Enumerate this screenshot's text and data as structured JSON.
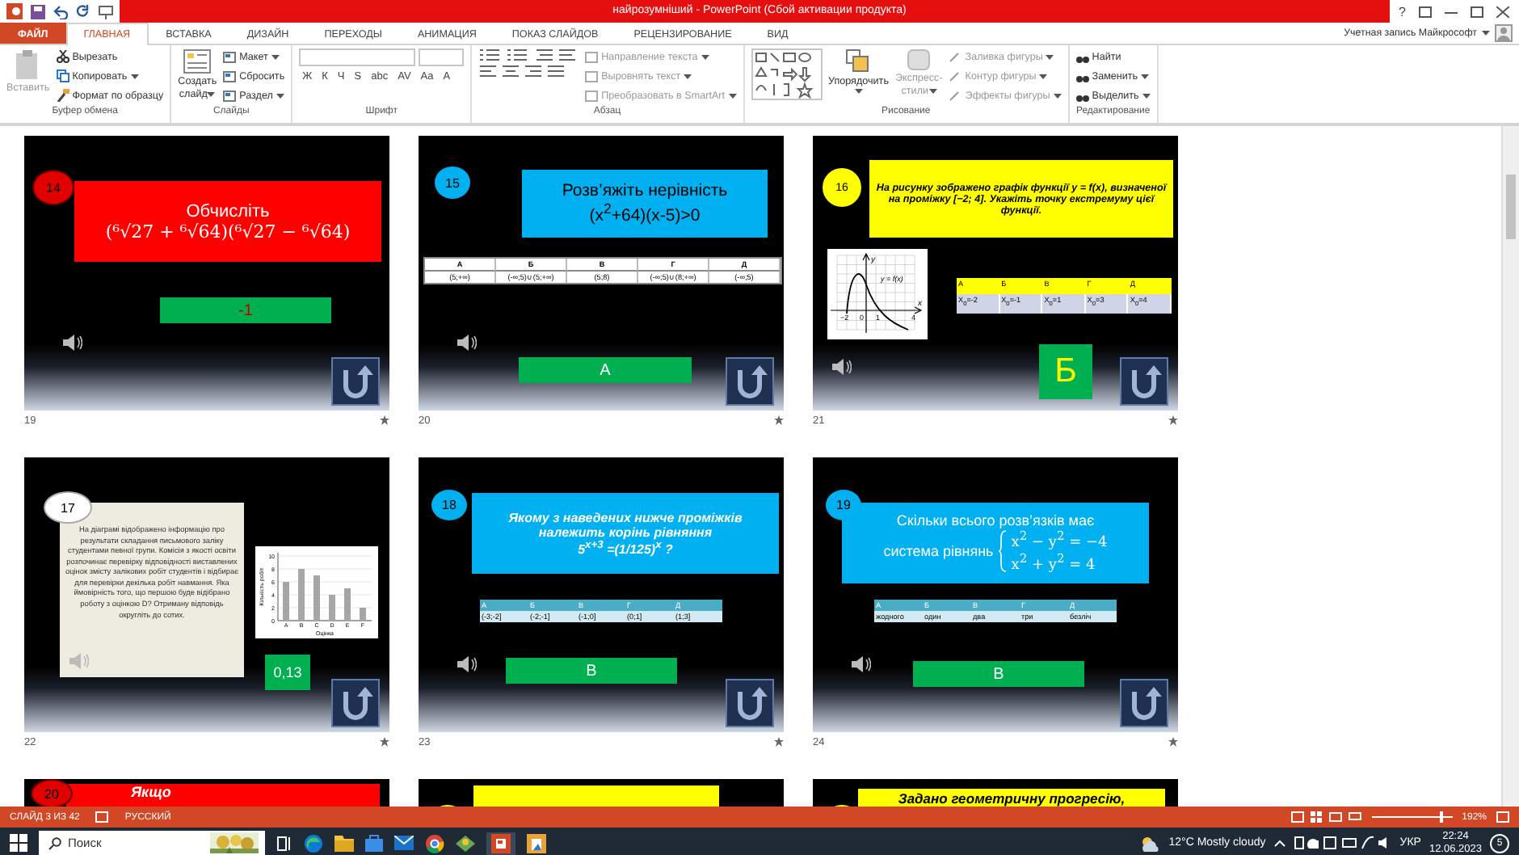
{
  "window": {
    "title": "найрозумніший - PowerPoint (Сбой активации продукта)",
    "help": "?"
  },
  "tabs": [
    {
      "label": "ФАЙЛ",
      "kind": "file",
      "selected": false
    },
    {
      "label": "ГЛАВНАЯ",
      "kind": "tab",
      "selected": true
    },
    {
      "label": "ВСТАВКА",
      "kind": "tab",
      "selected": false
    },
    {
      "label": "ДИЗАЙН",
      "kind": "tab",
      "selected": false
    },
    {
      "label": "ПЕРЕХОДЫ",
      "kind": "tab",
      "selected": false
    },
    {
      "label": "АНИМАЦИЯ",
      "kind": "tab",
      "selected": false
    },
    {
      "label": "ПОКАЗ СЛАЙДОВ",
      "kind": "tab",
      "selected": false
    },
    {
      "label": "РЕЦЕНЗИРОВАНИЕ",
      "kind": "tab",
      "selected": false
    },
    {
      "label": "ВИД",
      "kind": "tab",
      "selected": false
    }
  ],
  "account": "Учетная запись Майкрософт",
  "ribbon": {
    "clipboard": {
      "paste": "Вставить",
      "items": [
        {
          "label": "Вырезать",
          "menu": false
        },
        {
          "label": "Копировать",
          "menu": true
        },
        {
          "label": "Формат по образцу",
          "menu": false
        }
      ],
      "group": "Буфер обмена"
    },
    "slides": {
      "new": [
        "Создать",
        "слайд"
      ],
      "items": [
        {
          "label": "Макет",
          "menu": true
        },
        {
          "label": "Сбросить",
          "menu": false
        },
        {
          "label": "Раздел",
          "menu": true
        }
      ],
      "group": "Слайды"
    },
    "font": {
      "buttons": [
        "Ж",
        "К",
        "Ч",
        "S",
        "abc",
        "AV",
        "Aa",
        "A"
      ],
      "group": "Шрифт"
    },
    "paragraph": {
      "items": [
        {
          "label": "Направление текста",
          "disabled": true
        },
        {
          "label": "Выровнять текст",
          "disabled": true
        },
        {
          "label": "Преобразовать в SmartArt",
          "disabled": true
        }
      ],
      "group": "Абзац"
    },
    "drawing": {
      "arrange": "Упорядочить",
      "styles": [
        "Экспресс-",
        "стили"
      ],
      "styles_disabled": true,
      "items": [
        {
          "label": "Заливка фигуры",
          "disabled": true
        },
        {
          "label": "Контур фигуры",
          "disabled": true
        },
        {
          "label": "Эффекты фигуры",
          "disabled": true
        }
      ],
      "group": "Рисование"
    },
    "editing": {
      "items": [
        {
          "label": "Найти",
          "menu": false
        },
        {
          "label": "Заменить",
          "menu": true
        },
        {
          "label": "Выделить",
          "menu": true
        }
      ],
      "group": "Редактирование"
    }
  },
  "slides": [
    {
      "kind": "compute",
      "number": "19",
      "badge": "14",
      "question": {
        "lines": [
          "Обчисліть"
        ],
        "formula": "(⁶√27 + ⁶√64)(⁶√27 − ⁶√64)"
      },
      "answer": "-1"
    },
    {
      "kind": "inequality",
      "number": "20",
      "badge": "15",
      "question": {
        "lines": [
          "Розв’яжіть нерівність"
        ],
        "formula": "(x$^{2}$+64)(x-5)>0"
      },
      "table": {
        "headers": [
          "А",
          "Б",
          "В",
          "Г",
          "Д"
        ],
        "cells": [
          "(5;+∞)",
          "(-∞;5)∪(5;+∞)",
          "(5;8)",
          "(-∞;5)∪(8;+∞)",
          "(-∞;5)"
        ]
      },
      "answer": "А"
    },
    {
      "kind": "graph",
      "number": "21",
      "badge": "16",
      "question": {
        "lines": [
          "На рисунку зображено графік функції y = f(x), визначеної на проміжку [−2; 4]. Укажіть точку екстремуму цієї функції."
        ]
      },
      "graph": {
        "y_axis": "y",
        "x_axis": "x",
        "curve_label": "y = f(x)",
        "x_ticks": [
          "−2",
          "0",
          "1",
          "4"
        ]
      },
      "table": {
        "headers": [
          "А",
          "Б",
          "В",
          "Г",
          "Д"
        ],
        "cells": [
          "X$_{0}$=-2",
          "X$_{0}$=-1",
          "X$_{0}$=1",
          "X$_{0}$=3",
          "X$_{0}$=4"
        ]
      },
      "answer": "Б"
    },
    {
      "kind": "probability",
      "number": "22",
      "badge": "17",
      "question": {
        "lines": [
          "На діаграмі відображено інформацію про результати складання письмового заліку студентами певної групи. Комісія з якості освіти розпочинає перевірку відповідності виставлених оцінок змісту залікових робіт студентів і відбирає для перевірки декілька робіт навмання. Яка ймовірність того, що першою буде відібрано роботу з оцінкою D? Отриману відповідь округліть до сотих."
        ]
      },
      "chart_data": {
        "type": "bar",
        "xlabel": "Оцінка",
        "ylabel": "Кількість робіт",
        "categories": [
          "A",
          "B",
          "C",
          "D",
          "E",
          "F"
        ],
        "values": [
          6,
          8,
          7,
          4,
          5,
          2
        ],
        "ylim": [
          0,
          10
        ],
        "grid": true,
        "yticks": [
          0,
          2,
          4,
          6,
          8,
          10
        ]
      },
      "answer": "0,13"
    },
    {
      "kind": "interval",
      "number": "23",
      "badge": "18",
      "question": {
        "lines": [
          "Якому з наведених нижче проміжків",
          "належить корінь рівняння"
        ],
        "formula": "5$^{x+3}$ =(1/125)$^{x}$ ?"
      },
      "table": {
        "headers": [
          "А",
          "Б",
          "В",
          "Г",
          "Д"
        ],
        "cells": [
          "(-3;-2]",
          "(-2;-1]",
          "(-1;0]",
          "(0;1]",
          "(1;3]"
        ]
      },
      "answer": "В"
    },
    {
      "kind": "system",
      "number": "24",
      "badge": "19",
      "question": {
        "lines": [
          "Скільки всього розв’язків має"
        ]
      },
      "system": {
        "label": "система рівнянь",
        "equations": [
          "x$^{2}$ − y$^{2}$ = −4",
          "x$^{2}$ + y$^{2}$ = 4"
        ]
      },
      "table": {
        "headers": [
          "А",
          "Б",
          "В",
          "Г",
          "Д"
        ],
        "cells": [
          "жодного",
          "один",
          "два",
          "три",
          "безліч"
        ]
      },
      "answer": "В"
    },
    {
      "kind": "partial-red",
      "badge": "20",
      "question": {
        "lines": [
          "Якщо"
        ]
      }
    },
    {
      "kind": "partial-yellow"
    },
    {
      "kind": "partial-text",
      "question": {
        "lines": [
          "Задано геометричну  прогресію,"
        ]
      }
    }
  ],
  "status_bar": {
    "slide": "СЛАЙД 3 ИЗ 42",
    "language": "РУССКИЙ",
    "zoom": "192%",
    "zoom_level": {
      "level": 0.85
    }
  },
  "taskbar": {
    "search": "Поиск",
    "weather": "12°C  Mostly cloudy",
    "language": "УКР",
    "time": "22:24",
    "date": "12.06.2023",
    "notifications": "5"
  }
}
